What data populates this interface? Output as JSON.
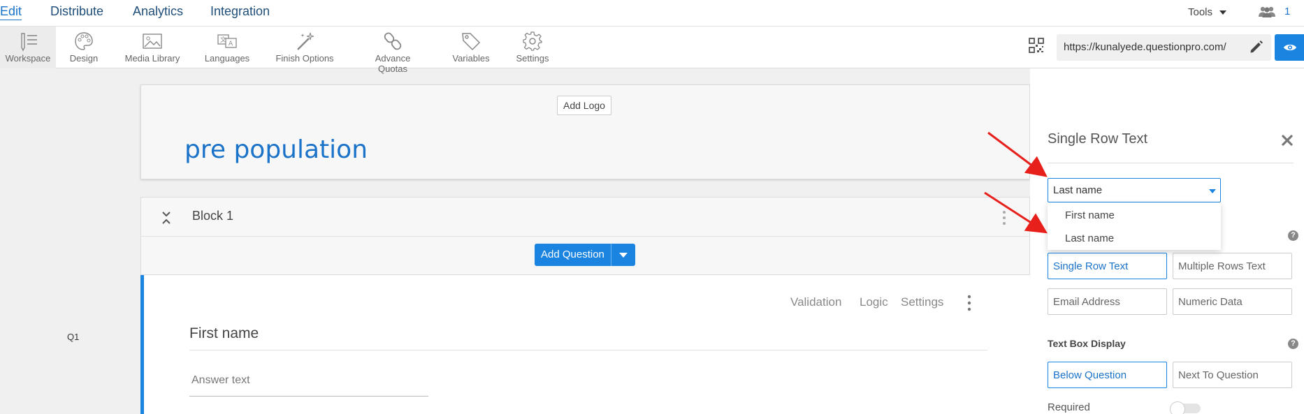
{
  "nav": {
    "edit": "Edit",
    "distribute": "Distribute",
    "analytics": "Analytics",
    "integration": "Integration",
    "tools": "Tools",
    "collaborator_count": "1"
  },
  "toolbar": {
    "workspace": "Workspace",
    "design": "Design",
    "media_library": "Media Library",
    "languages": "Languages",
    "finish_options": "Finish Options",
    "advance_quotas": "Advance Quotas",
    "variables": "Variables",
    "settings": "Settings",
    "url": "https://kunalyede.questionpro.com/"
  },
  "survey": {
    "add_logo": "Add Logo",
    "title": "pre population"
  },
  "block": {
    "title": "Block 1",
    "add_question": "Add Question"
  },
  "question": {
    "number": "Q1",
    "validation": "Validation",
    "logic": "Logic",
    "settings": "Settings",
    "text": "First name",
    "answer_placeholder": "Answer text"
  },
  "panel": {
    "title": "Single Row Text",
    "select_value": "Last name",
    "dropdown_options": [
      "First name",
      "Last name"
    ],
    "types": {
      "single_row": "Single Row Text",
      "multiple_rows": "Multiple Rows Text",
      "email": "Email Address",
      "numeric": "Numeric Data"
    },
    "text_box_display_label": "Text Box Display",
    "display": {
      "below": "Below Question",
      "next_to": "Next To Question"
    },
    "required_label": "Required",
    "help_glyph": "?"
  },
  "colors": {
    "accent": "#1a84e0",
    "link": "#1a73c9",
    "annotation": "#e8201c"
  },
  "icons": [
    "eye-icon",
    "pencil-icon",
    "qr-code-icon",
    "users-icon",
    "close-icon",
    "help-icon"
  ]
}
